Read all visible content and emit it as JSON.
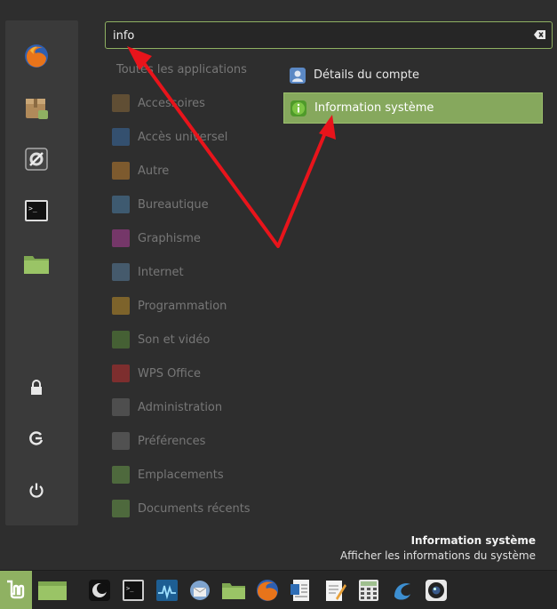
{
  "search": {
    "value": "info"
  },
  "categories": {
    "all": "Toutes les applications",
    "items": [
      {
        "label": "Accessoires",
        "color": "#8a6a3a"
      },
      {
        "label": "Accès universel",
        "color": "#3a6ea5"
      },
      {
        "label": "Autre",
        "color": "#c08030"
      },
      {
        "label": "Bureautique",
        "color": "#4d7fa8"
      },
      {
        "label": "Graphisme",
        "color": "#b0409a"
      },
      {
        "label": "Internet",
        "color": "#5a7fa0"
      },
      {
        "label": "Programmation",
        "color": "#c0902a"
      },
      {
        "label": "Son et vidéo",
        "color": "#5a8a3a"
      },
      {
        "label": "WPS Office",
        "color": "#c03030"
      },
      {
        "label": "Administration",
        "color": "#6a6a6a"
      },
      {
        "label": "Préférences",
        "color": "#707070"
      },
      {
        "label": "Emplacements",
        "color": "#6a9a4a"
      },
      {
        "label": "Documents récents",
        "color": "#6a9a4a"
      }
    ]
  },
  "results": [
    {
      "label": "Détails du compte",
      "icon": "user-account-icon",
      "selected": false
    },
    {
      "label": "Information système",
      "icon": "info-icon",
      "selected": true
    }
  ],
  "description": {
    "title": "Information système",
    "text": "Afficher les informations du système"
  },
  "colors": {
    "accent": "#8fb162",
    "selected_bg": "#86a85d",
    "annotation_arrow": "#e8141b"
  }
}
